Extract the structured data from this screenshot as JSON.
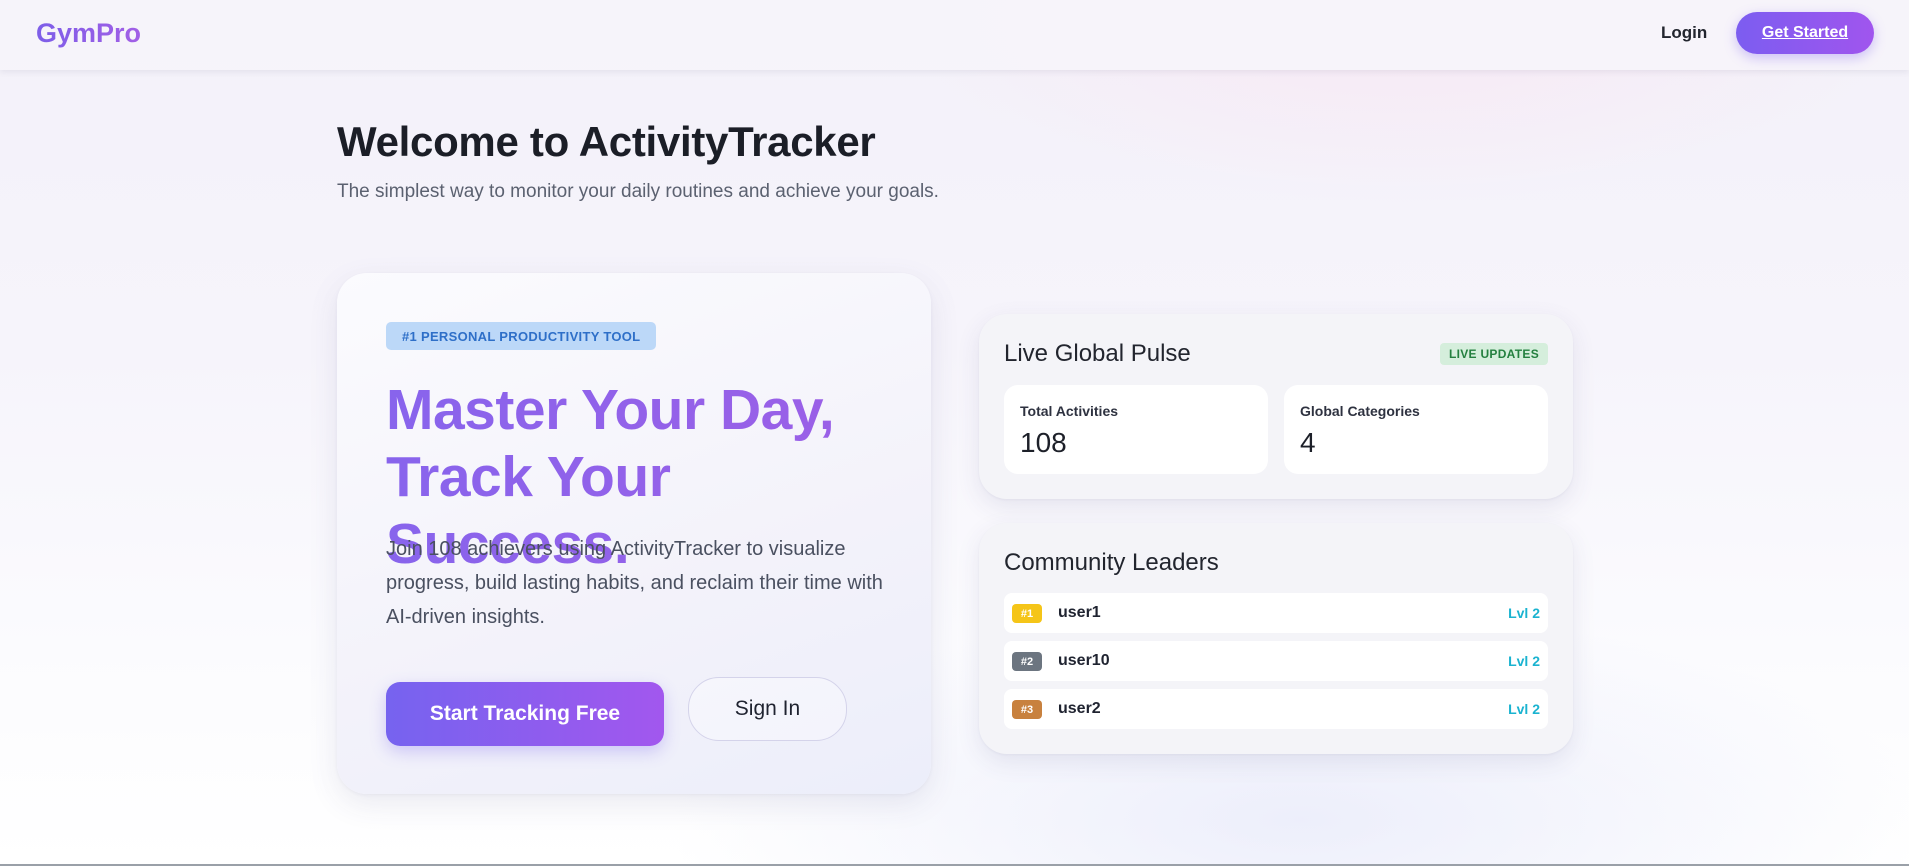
{
  "navbar": {
    "brand": "GymPro",
    "login_label": "Login",
    "get_started_label": "Get Started"
  },
  "header": {
    "title": "Welcome to ActivityTracker",
    "subtitle": "The simplest way to monitor your daily routines and achieve your goals."
  },
  "hero": {
    "badge": "#1 PERSONAL PRODUCTIVITY TOOL",
    "headline_line1": "Master Your Day,",
    "headline_line2": "Track Your Success.",
    "body": "Join 108 achievers using ActivityTracker to visualize progress, build lasting habits, and reclaim their time with AI-driven insights.",
    "primary_cta": "Start Tracking Free",
    "secondary_cta": "Sign In"
  },
  "pulse": {
    "title": "Live Global Pulse",
    "live_label": "LIVE UPDATES",
    "stats": [
      {
        "label": "Total Activities",
        "value": "108"
      },
      {
        "label": "Global Categories",
        "value": "4"
      }
    ]
  },
  "leaders": {
    "title": "Community Leaders",
    "rows": [
      {
        "rank": "#1",
        "name": "user1",
        "level": "Lvl 2",
        "rank_color": "#f5c518"
      },
      {
        "rank": "#2",
        "name": "user10",
        "level": "Lvl 2",
        "rank_color": "#6c7580"
      },
      {
        "rank": "#3",
        "name": "user2",
        "level": "Lvl 2",
        "rank_color": "#c8813e"
      }
    ]
  },
  "colors": {
    "brand_accent": "#8b63ea",
    "button_gradient_start": "#7663ef",
    "button_gradient_end": "#a257ee",
    "live_green": "#24803f",
    "level_cyan": "#1ab3d0"
  }
}
